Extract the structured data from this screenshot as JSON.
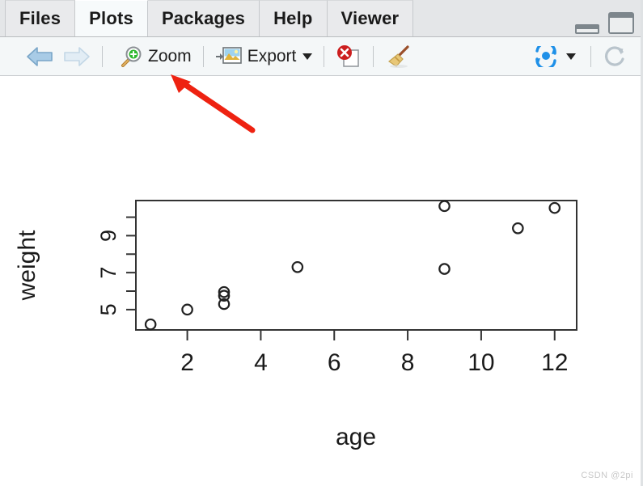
{
  "window": {
    "minimize_icon": "minimize-icon",
    "maximize_icon": "maximize-icon"
  },
  "tabs": [
    {
      "label": "Files",
      "active": false
    },
    {
      "label": "Plots",
      "active": true
    },
    {
      "label": "Packages",
      "active": false
    },
    {
      "label": "Help",
      "active": false
    },
    {
      "label": "Viewer",
      "active": false
    }
  ],
  "toolbar": {
    "back_icon": "back-arrow-icon",
    "forward_icon": "forward-arrow-icon",
    "zoom_icon": "magnifier-plus-icon",
    "zoom_label": "Zoom",
    "export_icon": "export-image-icon",
    "export_label": "Export",
    "export_caret_icon": "chevron-down-icon",
    "remove_plot_icon": "remove-plot-icon",
    "clear_plots_icon": "broom-icon",
    "publish_icon": "publish-icon",
    "publish_caret_icon": "chevron-down-icon",
    "refresh_icon": "refresh-icon"
  },
  "annotation": {
    "arrow_color": "#ee2211",
    "arrow_name": "red-pointer-arrow"
  },
  "watermark": {
    "text": "CSDN @2pi"
  },
  "chart_data": {
    "type": "scatter",
    "title": "",
    "xlabel": "age",
    "ylabel": "weight",
    "xlim": [
      0.6,
      12.6
    ],
    "ylim": [
      3.9,
      10.9
    ],
    "grid": false,
    "legend": "none",
    "marker": "open-circle",
    "x_ticks": [
      2,
      4,
      6,
      8,
      10,
      12
    ],
    "x_tick_labels": [
      "2",
      "4",
      "6",
      "8",
      "10",
      "12"
    ],
    "y_ticks": [
      5,
      6,
      7,
      8,
      9,
      10
    ],
    "y_tick_labels": [
      "5",
      "",
      "7",
      "",
      "9",
      ""
    ],
    "y_labeled_ticks": [
      5,
      7,
      9
    ],
    "points": [
      {
        "x": 1,
        "y": 4.2
      },
      {
        "x": 2,
        "y": 5.0
      },
      {
        "x": 3,
        "y": 5.95
      },
      {
        "x": 3,
        "y": 5.75
      },
      {
        "x": 3,
        "y": 5.3
      },
      {
        "x": 5,
        "y": 7.3
      },
      {
        "x": 9,
        "y": 10.6
      },
      {
        "x": 9,
        "y": 7.2
      },
      {
        "x": 11,
        "y": 9.4
      },
      {
        "x": 12,
        "y": 10.5
      }
    ]
  }
}
